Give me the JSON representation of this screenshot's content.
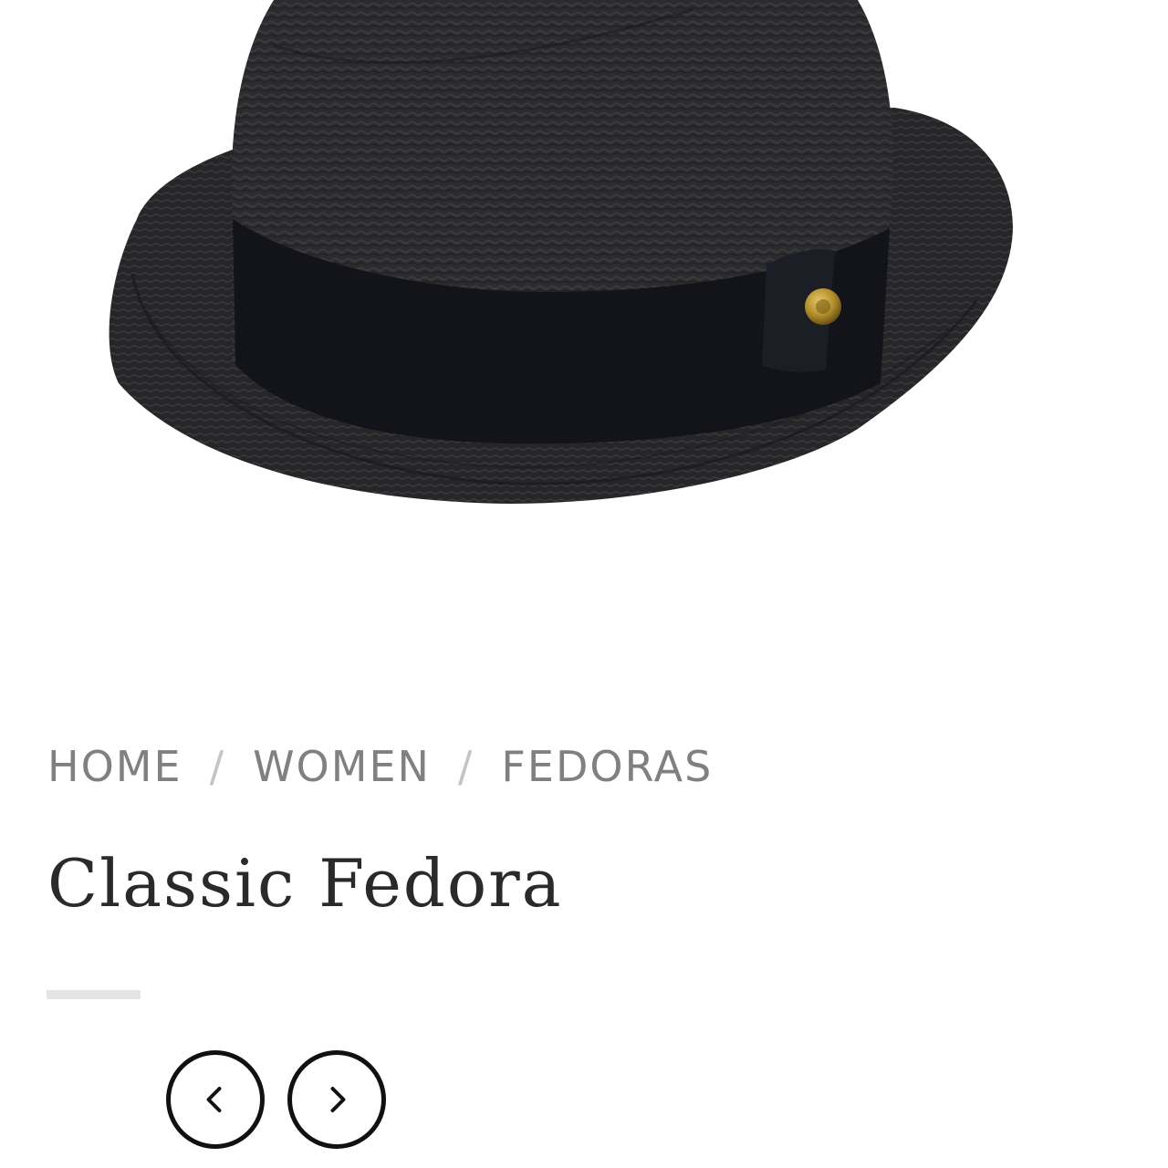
{
  "breadcrumb": {
    "items": [
      {
        "label": "HOME"
      },
      {
        "label": "WOMEN"
      },
      {
        "label": "FEDORAS"
      }
    ],
    "separator": "/"
  },
  "product": {
    "title": "Classic Fedora"
  },
  "gallery": {
    "prev_icon": "chevron-left-icon",
    "next_icon": "chevron-right-icon"
  },
  "colors": {
    "breadcrumb_text": "#808080",
    "title_text": "#2a2a2a",
    "hat_body": "#2b2b2d",
    "hat_band": "#111318",
    "hat_pin": "#b8962e"
  }
}
